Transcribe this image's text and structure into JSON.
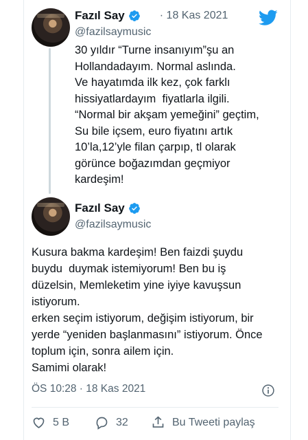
{
  "tweet1": {
    "author_name": "Fazıl Say",
    "handle": "@fazilsaymusic",
    "date": "· 18 Kas 2021",
    "text_lines": [
      "30 yıldır “Turne insanıyım”şu an",
      "Hollandadayım. Normal aslında.",
      "Ve hayatımda ilk kez, çok farklı",
      "hissiyatlardayım  fiyatlarla ilgili.",
      "“Normal bir akşam yemeğini” geçtim,",
      "Su bile içsem, euro fiyatını artık",
      "10’la,12’yle filan çarpıp, tl olarak",
      "görünce boğazımdan geçmiyor",
      "kardeşim!"
    ]
  },
  "tweet2": {
    "author_name": "Fazıl Say",
    "handle": "@fazilsaymusic",
    "text_lines": [
      "Kusura bakma kardeşim! Ben faizdi şuydu",
      "buydu  duymak istemiyorum! Ben bu iş",
      "düzelsin, Memleketim yine iyiye kavuşsun",
      "istiyorum.",
      "erken seçim istiyorum, değişim istiyorum, bir",
      "yerde “yeniden başlanmasını” istiyorum. Önce",
      "toplum için, sonra ailem için.",
      "Samimi olarak!"
    ],
    "timestamp": "ÖS 10:28 · 18 Kas 2021"
  },
  "actions": {
    "like_count": "5 B",
    "reply_count": "32",
    "share_label": "Bu Tweeti paylaş"
  },
  "icons": {
    "brand": "twitter-bird-icon",
    "verified": "verified-badge-icon",
    "info": "info-icon",
    "like": "heart-icon",
    "reply": "comment-bubble-icon",
    "share": "share-upload-icon"
  },
  "colors": {
    "twitter_blue": "#1d9bf0",
    "text_primary": "#0f1419",
    "text_secondary": "#536471",
    "thread_line": "#cfd9de"
  }
}
